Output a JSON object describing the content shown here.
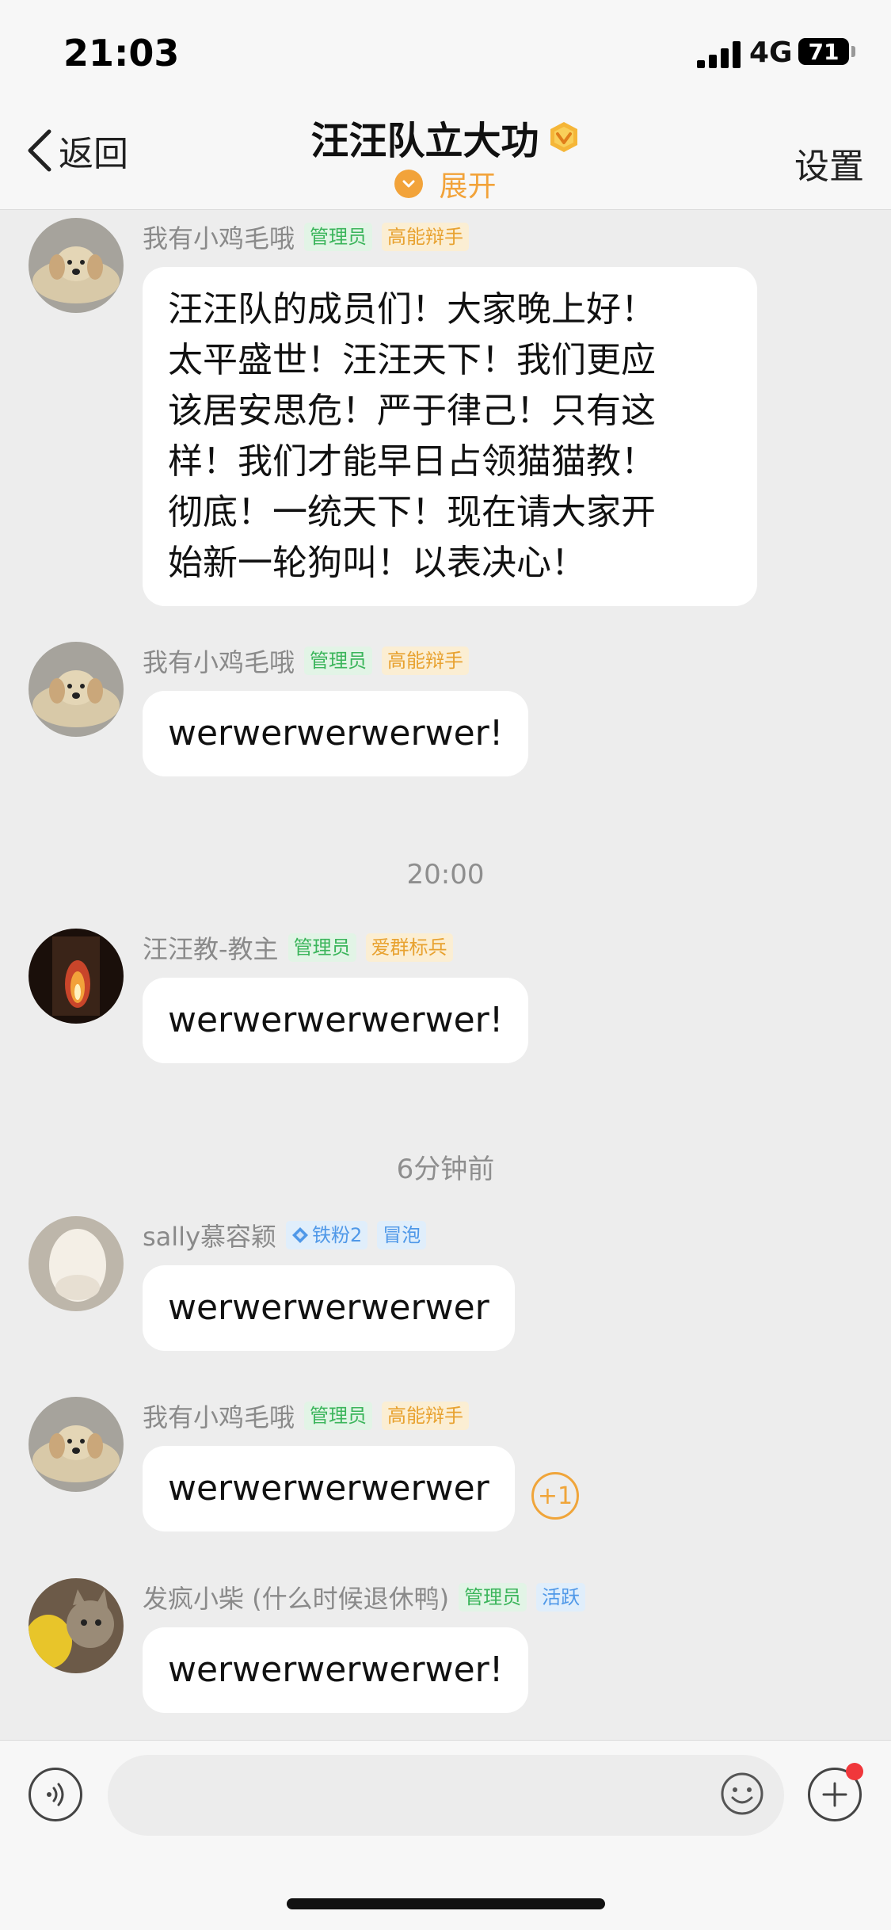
{
  "status_bar": {
    "time": "21:03",
    "network": "4G",
    "battery": "71"
  },
  "header": {
    "back_label": "返回",
    "title": "汪汪队立大功",
    "expand_label": "展开",
    "settings_label": "设置"
  },
  "messages": [
    {
      "sender": "我有小鸡毛哦",
      "tags": [
        "管理员",
        "高能辩手"
      ],
      "lines": [
        "汪汪队的成员们！大家晚上好！",
        "太平盛世！汪汪天下！我们更应",
        "该居安思危！严于律己！只有这",
        "样！我们才能早日占领猫猫教！",
        "彻底！一统天下！现在请大家开",
        "始新一轮狗叫！以表决心！"
      ]
    },
    {
      "sender": "我有小鸡毛哦",
      "tags": [
        "管理员",
        "高能辩手"
      ],
      "text": "werwerwerwerwer!"
    },
    {
      "sender": "汪汪教-教主",
      "tags": [
        "管理员",
        "爱群标兵"
      ],
      "text": "werwerwerwerwer!"
    },
    {
      "sender": "sally慕容颖",
      "tags": [
        "铁粉2",
        "冒泡"
      ],
      "text": "werwerwerwerwer"
    },
    {
      "sender": "我有小鸡毛哦",
      "tags": [
        "管理员",
        "高能辩手"
      ],
      "text": "werwerwerwerwer",
      "plus_one": "+1"
    },
    {
      "sender": "发疯小柴 (什么时候退休鸭)",
      "tags": [
        "管理员",
        "活跃"
      ],
      "text": "werwerwerwerwer!"
    }
  ],
  "timestamps": [
    "20:00",
    "6分钟前"
  ],
  "input": {
    "placeholder": ""
  },
  "colors": {
    "background": "#ededed",
    "admin_tag": "#3bb55b",
    "title_tag": "#e8a230",
    "fan_tag": "#4f98e8",
    "accent": "#f2a33a"
  }
}
